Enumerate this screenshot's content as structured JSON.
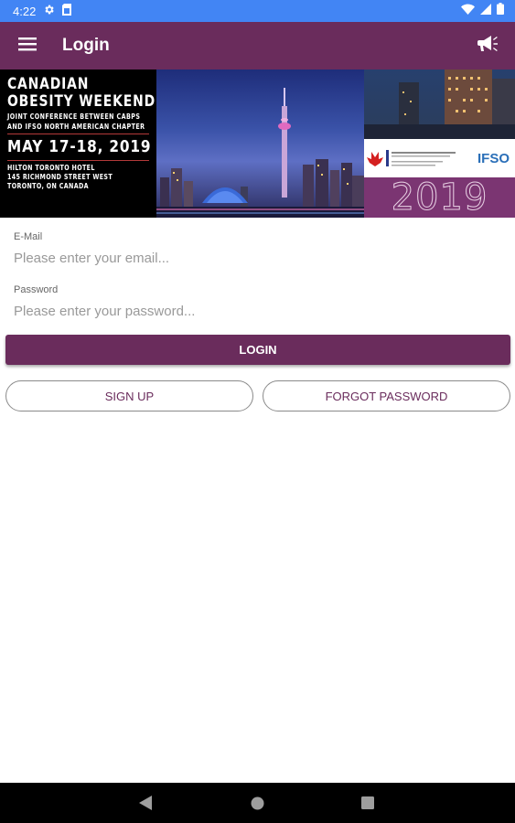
{
  "status_bar": {
    "time": "4:22",
    "icons": [
      "gear-icon",
      "sim-card-icon",
      "wifi-icon",
      "signal-icon",
      "battery-icon"
    ],
    "color": "#4285f4"
  },
  "app_bar": {
    "title": "Login",
    "menu_icon": "hamburger-menu-icon",
    "action_icon": "megaphone-icon",
    "color": "#6a2c5c"
  },
  "banner": {
    "title_line1": "CANADIAN",
    "title_line2": "OBESITY WEEKEND",
    "subtitle_line1": "JOINT CONFERENCE BETWEEN CABPS",
    "subtitle_line2": "AND IFSO NORTH AMERICAN CHAPTER",
    "dates": "MAY 17-18, 2019",
    "venue_line1": "HILTON TORONTO HOTEL",
    "venue_line2": "145 RICHMOND STREET WEST",
    "venue_line3": "TORONTO, ON CANADA",
    "logo_text": "IFSO",
    "year": "2019"
  },
  "form": {
    "email": {
      "label": "E-Mail",
      "placeholder": "Please enter your email...",
      "value": ""
    },
    "password": {
      "label": "Password",
      "placeholder": "Please enter your password...",
      "value": ""
    },
    "login_label": "LOGIN",
    "signup_label": "SIGN UP",
    "forgot_label": "FORGOT PASSWORD"
  },
  "nav_bar": {
    "icons": [
      "back-icon",
      "home-icon",
      "recents-icon"
    ]
  }
}
